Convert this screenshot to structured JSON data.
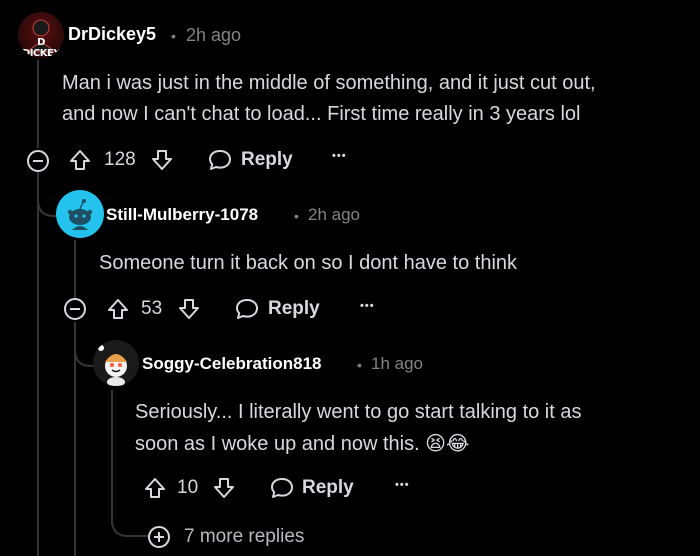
{
  "comments": [
    {
      "username": "DrDickey5",
      "avatar_text": "D DICKEY",
      "separator": "•",
      "time": "2h ago",
      "body_lines": [
        "Man i was just in the middle of something, and it just cut out,",
        "and now I can't chat to load... First time really in 3 years lol"
      ],
      "votes": "128",
      "reply_label": "Reply",
      "more_label": "•••"
    },
    {
      "username": "Still-Mulberry-1078",
      "separator": "•",
      "time": "2h ago",
      "body_lines": [
        "Someone turn it back on so I dont have to think"
      ],
      "votes": "53",
      "reply_label": "Reply",
      "more_label": "•••"
    },
    {
      "username": "Soggy-Celebration818",
      "separator": "•",
      "time": "1h ago",
      "body_lines": [
        "Seriously... I literally went to go start talking to it as",
        "soon as I woke up and now this. 😫😂"
      ],
      "votes": "10",
      "reply_label": "Reply",
      "more_label": "•••"
    }
  ],
  "more_replies_label": "7 more replies",
  "colors": {
    "background": "#000000",
    "text": "#d7dadc",
    "muted": "#818384",
    "thread_line": "#343536",
    "avatar_blue": "#24c3ee",
    "avatar_red": "#8b1d1d"
  }
}
